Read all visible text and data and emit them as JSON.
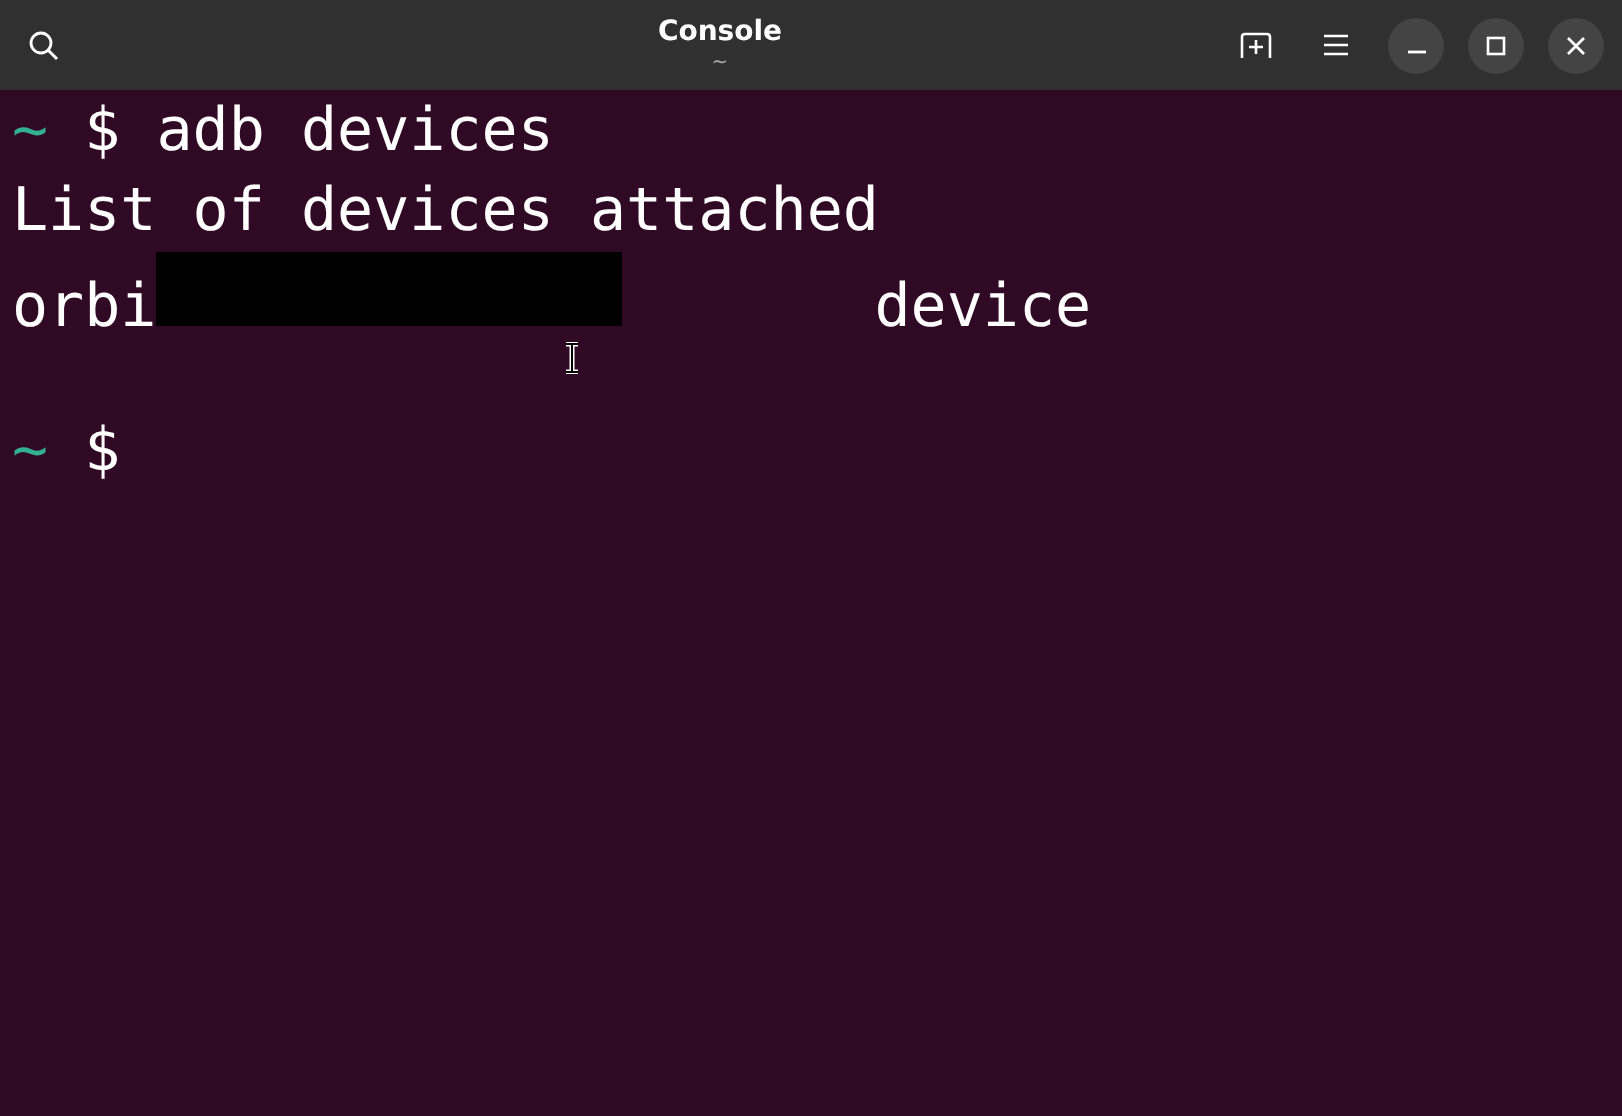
{
  "window": {
    "title": "Console",
    "subtitle": "~"
  },
  "terminal": {
    "lines": [
      {
        "kind": "prompt",
        "dir": "~",
        "symbol": "$",
        "command": "adb devices"
      },
      {
        "kind": "output",
        "text": "List of devices attached"
      },
      {
        "kind": "device",
        "serial": "orbi",
        "redacted": true,
        "state": "device"
      },
      {
        "kind": "blank"
      },
      {
        "kind": "prompt",
        "dir": "~",
        "symbol": "$"
      }
    ]
  }
}
